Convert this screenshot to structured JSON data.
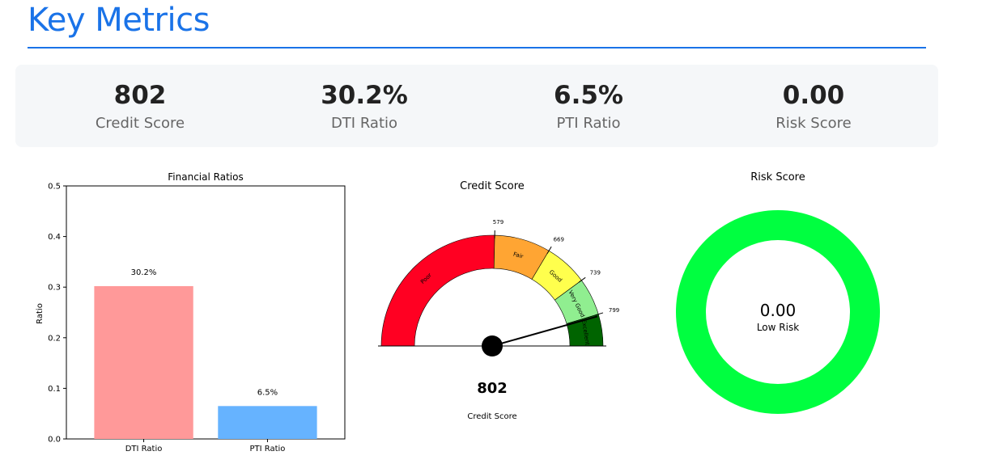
{
  "page": {
    "title": "Key Metrics"
  },
  "metrics": [
    {
      "value": "802",
      "label": "Credit Score"
    },
    {
      "value": "30.2%",
      "label": "DTI Ratio"
    },
    {
      "value": "6.5%",
      "label": "PTI Ratio"
    },
    {
      "value": "0.00",
      "label": "Risk Score"
    }
  ],
  "chart_data": [
    {
      "type": "bar",
      "title": "Financial Ratios",
      "xlabel": "",
      "ylabel": "Ratio",
      "categories": [
        "DTI Ratio",
        "PTI Ratio"
      ],
      "values": [
        0.302,
        0.065
      ],
      "data_labels": [
        "30.2%",
        "6.5%"
      ],
      "colors": [
        "#ff9999",
        "#66b3ff"
      ],
      "ylim": [
        0,
        0.5
      ],
      "yticks": [
        "0.0",
        "0.1",
        "0.2",
        "0.3",
        "0.4",
        "0.5"
      ],
      "grid": false
    },
    {
      "type": "gauge",
      "title": "Credit Score",
      "value": 802,
      "value_label": "802",
      "caption": "Credit Score",
      "range": [
        300,
        850
      ],
      "segments": [
        {
          "label": "Poor",
          "from": 300,
          "to": 579,
          "color": "#ff0022"
        },
        {
          "label": "Fair",
          "from": 579,
          "to": 669,
          "color": "#ffa533"
        },
        {
          "label": "Good",
          "from": 669,
          "to": 739,
          "color": "#ffff4d"
        },
        {
          "label": "Very Good",
          "from": 739,
          "to": 799,
          "color": "#90ee90"
        },
        {
          "label": "Excellent",
          "from": 799,
          "to": 850,
          "color": "#006400"
        }
      ],
      "tick_labels": [
        "579",
        "669",
        "739",
        "799"
      ]
    },
    {
      "type": "donut",
      "title": "Risk Score",
      "value": 0.0,
      "value_label": "0.00",
      "sublabel": "Low Risk",
      "color": "#00ff40"
    }
  ]
}
